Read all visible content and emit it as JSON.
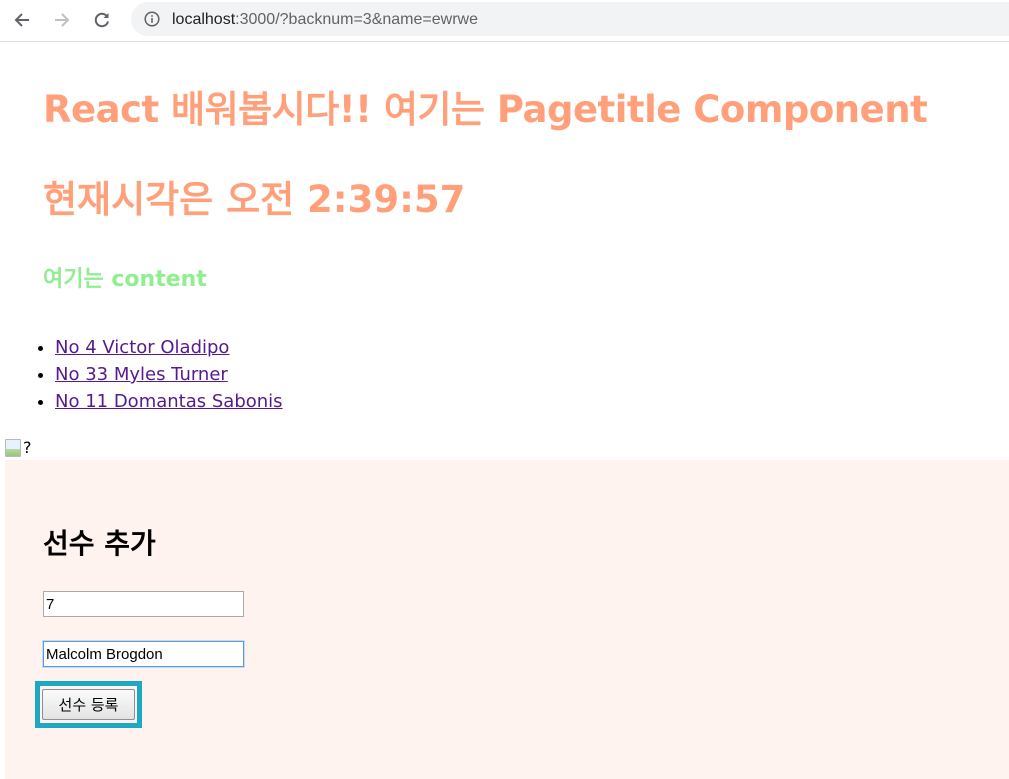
{
  "browser": {
    "url_host": "localhost",
    "url_rest": ":3000/?backnum=3&name=ewrwe",
    "icons": {
      "back": "arrow-left-icon",
      "forward": "arrow-right-icon",
      "reload": "reload-icon",
      "site_info": "info-icon"
    }
  },
  "page": {
    "title": "React 배워봅시다!! 여기는 Pagetitle Component",
    "clock": "현재시각은 오전 2:39:57",
    "content_heading": "여기는 content",
    "players": [
      {
        "label": "No 4 Victor Oladipo"
      },
      {
        "label": "No 33 Myles Turner"
      },
      {
        "label": "No 11 Domantas Sabonis"
      }
    ],
    "broken_image_alt": "?"
  },
  "form": {
    "title": "선수 추가",
    "number_value": "7",
    "name_value": "Malcolm Brogdon",
    "submit_label": "선수 등록"
  },
  "colors": {
    "title": "#ffa07a",
    "content_heading": "#90ee90",
    "form_background": "#fff3ef",
    "button_highlight": "#1fa8c4",
    "link": "#551a8b"
  }
}
